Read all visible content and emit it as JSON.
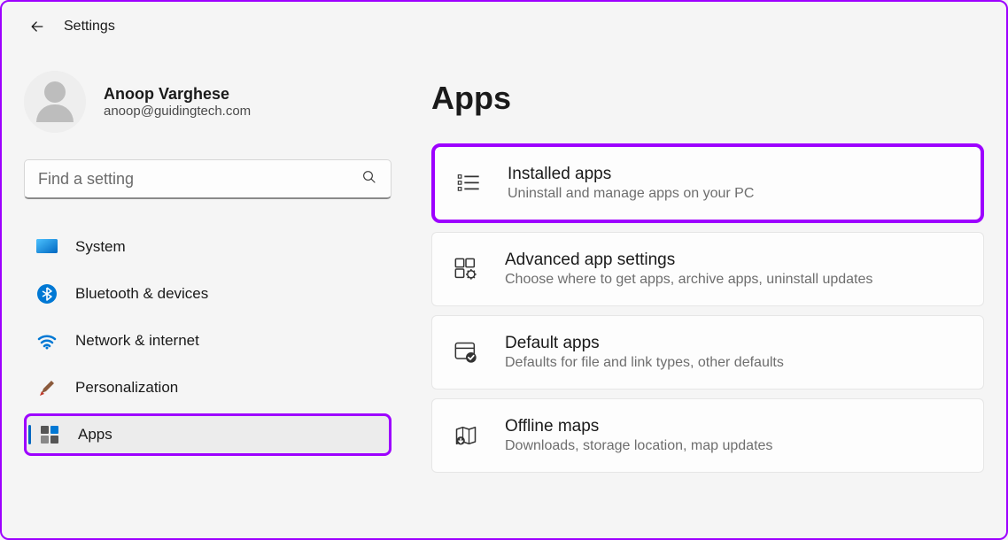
{
  "header": {
    "title": "Settings"
  },
  "profile": {
    "name": "Anoop Varghese",
    "email": "anoop@guidingtech.com"
  },
  "search": {
    "placeholder": "Find a setting"
  },
  "sidebar": {
    "items": [
      {
        "label": "System",
        "icon": "system"
      },
      {
        "label": "Bluetooth & devices",
        "icon": "bluetooth"
      },
      {
        "label": "Network & internet",
        "icon": "wifi"
      },
      {
        "label": "Personalization",
        "icon": "brush"
      },
      {
        "label": "Apps",
        "icon": "apps",
        "selected": true
      }
    ]
  },
  "main": {
    "title": "Apps",
    "cards": [
      {
        "title": "Installed apps",
        "desc": "Uninstall and manage apps on your PC",
        "icon": "list",
        "highlight": true
      },
      {
        "title": "Advanced app settings",
        "desc": "Choose where to get apps, archive apps, uninstall updates",
        "icon": "grid-gear"
      },
      {
        "title": "Default apps",
        "desc": "Defaults for file and link types, other defaults",
        "icon": "window-check"
      },
      {
        "title": "Offline maps",
        "desc": "Downloads, storage location, map updates",
        "icon": "map"
      }
    ]
  }
}
